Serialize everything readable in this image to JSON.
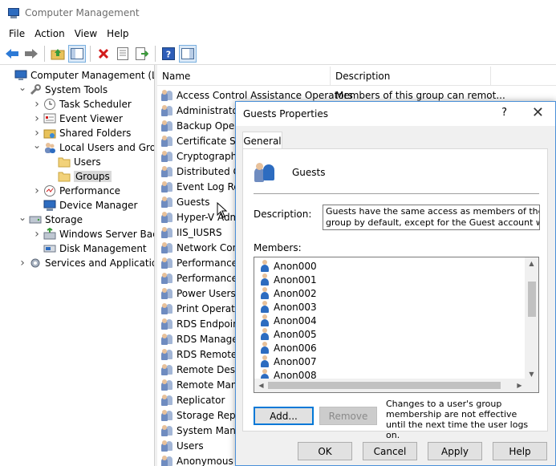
{
  "window": {
    "title": "Computer Management"
  },
  "menu": [
    "File",
    "Action",
    "View",
    "Help"
  ],
  "toolbar": {
    "buttons": [
      "back-arrow-icon",
      "forward-arrow-icon",
      "up-folder-icon",
      "show-hide-tree-icon",
      "delete-icon",
      "properties-icon",
      "export-icon",
      "help-icon",
      "action-pane-icon"
    ]
  },
  "tree": {
    "items": [
      {
        "label": "Computer Management (Local",
        "indent": 0,
        "exp": "",
        "icon": "computer-icon"
      },
      {
        "label": "System Tools",
        "indent": 1,
        "exp": "v",
        "icon": "tools-icon"
      },
      {
        "label": "Task Scheduler",
        "indent": 2,
        "exp": ">",
        "icon": "clock-icon"
      },
      {
        "label": "Event Viewer",
        "indent": 2,
        "exp": ">",
        "icon": "event-viewer-icon"
      },
      {
        "label": "Shared Folders",
        "indent": 2,
        "exp": ">",
        "icon": "shared-folder-icon"
      },
      {
        "label": "Local Users and Groups",
        "indent": 2,
        "exp": "v",
        "icon": "users-icon"
      },
      {
        "label": "Users",
        "indent": 3,
        "exp": "",
        "icon": "folder-icon"
      },
      {
        "label": "Groups",
        "indent": 3,
        "exp": "",
        "icon": "folder-icon",
        "selected": true
      },
      {
        "label": "Performance",
        "indent": 2,
        "exp": ">",
        "icon": "performance-icon"
      },
      {
        "label": "Device Manager",
        "indent": 2,
        "exp": "",
        "icon": "device-manager-icon"
      },
      {
        "label": "Storage",
        "indent": 1,
        "exp": "v",
        "icon": "storage-icon"
      },
      {
        "label": "Windows Server Backup",
        "indent": 2,
        "exp": ">",
        "icon": "backup-icon"
      },
      {
        "label": "Disk Management",
        "indent": 2,
        "exp": "",
        "icon": "disk-icon"
      },
      {
        "label": "Services and Applications",
        "indent": 1,
        "exp": ">",
        "icon": "services-icon"
      }
    ]
  },
  "list": {
    "columns": [
      "Name",
      "Description"
    ],
    "rows": [
      {
        "name": "Access Control Assistance Operators",
        "desc": "Members of this group can remot..."
      },
      {
        "name": "Administrators",
        "desc": ""
      },
      {
        "name": "Backup Operators",
        "desc": ""
      },
      {
        "name": "Certificate Service DCOM Access",
        "desc": ""
      },
      {
        "name": "Cryptographic Operators",
        "desc": ""
      },
      {
        "name": "Distributed COM Users",
        "desc": ""
      },
      {
        "name": "Event Log Readers",
        "desc": ""
      },
      {
        "name": "Guests",
        "desc": ""
      },
      {
        "name": "Hyper-V Administrators",
        "desc": ""
      },
      {
        "name": "IIS_IUSRS",
        "desc": ""
      },
      {
        "name": "Network Configuration Operators",
        "desc": ""
      },
      {
        "name": "Performance Log Users",
        "desc": ""
      },
      {
        "name": "Performance Monitor Users",
        "desc": ""
      },
      {
        "name": "Power Users",
        "desc": ""
      },
      {
        "name": "Print Operators",
        "desc": ""
      },
      {
        "name": "RDS Endpoint Servers",
        "desc": ""
      },
      {
        "name": "RDS Management Servers",
        "desc": ""
      },
      {
        "name": "RDS Remote Access Servers",
        "desc": ""
      },
      {
        "name": "Remote Desktop Users",
        "desc": ""
      },
      {
        "name": "Remote Management Users",
        "desc": ""
      },
      {
        "name": "Replicator",
        "desc": ""
      },
      {
        "name": "Storage Replica Administrators",
        "desc": ""
      },
      {
        "name": "System Managed Accounts Group",
        "desc": ""
      },
      {
        "name": "Users",
        "desc": ""
      },
      {
        "name": "Anonymous",
        "desc": ""
      }
    ]
  },
  "dialog": {
    "title": "Guests Properties",
    "help_glyph": "?",
    "close_glyph": "✕",
    "tab": "General",
    "group_name": "Guests",
    "description_label": "Description:",
    "description_line1": "Guests have the same access as members of the Users",
    "description_line2": "group by default, except for the Guest account which is",
    "members_label": "Members:",
    "members": [
      "Anon000",
      "Anon001",
      "Anon002",
      "Anon003",
      "Anon004",
      "Anon005",
      "Anon006",
      "Anon007",
      "Anon008"
    ],
    "add_label": "Add...",
    "remove_label": "Remove",
    "note": "Changes to a user's group membership are not effective until the next time the user logs on.",
    "ok_label": "OK",
    "cancel_label": "Cancel",
    "apply_label": "Apply",
    "help_label": "Help"
  }
}
